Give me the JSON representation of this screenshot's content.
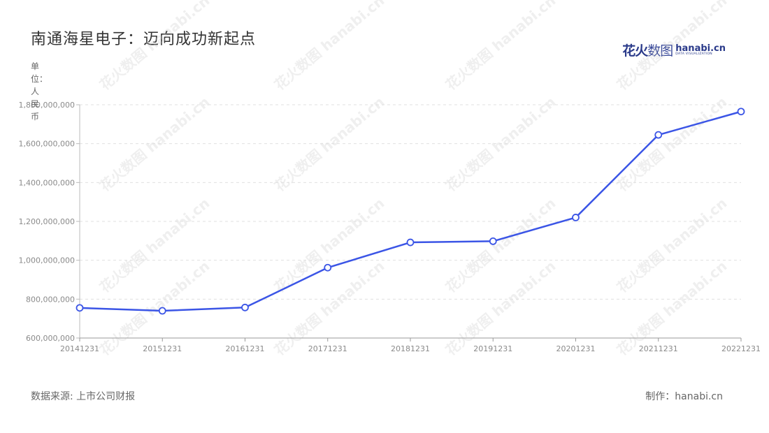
{
  "header": {
    "title": "南通海星电子：迈向成功新起点",
    "logo_cn_bold": "花火",
    "logo_cn_light": "数图",
    "logo_en": "hanabi.cn",
    "logo_en_sub": "DATA VISUALIZATION"
  },
  "unit_label": "单位：人民币",
  "footer": {
    "source": "数据来源: 上市公司财报",
    "credit": "制作：hanabi.cn"
  },
  "watermark_text": "花火数图 hanabi.cn",
  "chart_data": {
    "type": "line",
    "title": "南通海星电子：迈向成功新起点",
    "xlabel": "",
    "ylabel": "单位：人民币",
    "categories": [
      "20141231",
      "20151231",
      "20161231",
      "20171231",
      "20181231",
      "20191231",
      "20201231",
      "20211231",
      "20221231"
    ],
    "series": [
      {
        "values": [
          755000000,
          740000000,
          757000000,
          962000000,
          1092000000,
          1098000000,
          1220000000,
          1645000000,
          1765000000
        ]
      }
    ],
    "ylim": [
      600000000,
      1800000000
    ],
    "yticks": [
      600000000,
      800000000,
      1000000000,
      1200000000,
      1400000000,
      1600000000,
      1800000000
    ],
    "ytick_labels": [
      "600,000,000",
      "800,000,000",
      "1,000,000,000",
      "1,200,000,000",
      "1,400,000,000",
      "1,600,000,000",
      "1,800,000,000"
    ],
    "grid": true,
    "line_color": "#3b55e6"
  }
}
